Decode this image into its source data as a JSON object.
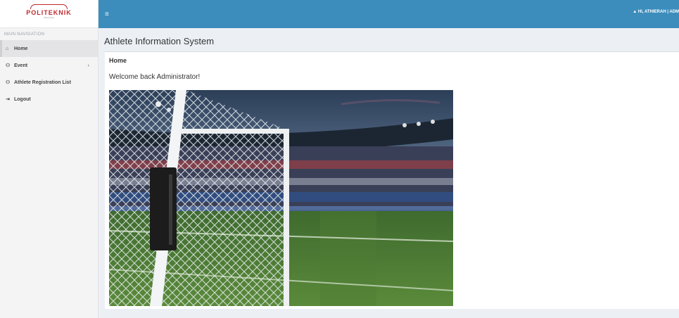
{
  "app": {
    "title": "Athlete Information System",
    "logo_text": "POLITEKNIK",
    "logo_subtext": "MALAYSIA"
  },
  "topbar": {
    "toggle_icon": "hamburger-icon",
    "user_icon": "user-icon",
    "user_greeting": "Hi, ATHIERAH | ADM"
  },
  "sidebar": {
    "header": "MAIN NAVIGATION",
    "items": [
      {
        "label": "Home",
        "icon": "home-icon",
        "active": true
      },
      {
        "label": "Event",
        "icon": "users-icon",
        "has_caret": true
      },
      {
        "label": "Athlete Registration List",
        "icon": "users-icon"
      },
      {
        "label": "Logout",
        "icon": "logout-icon"
      }
    ]
  },
  "main": {
    "panel_heading": "Home",
    "welcome_text": "Welcome back Administrator!",
    "image_subject": "football goal net in stadium at dusk"
  },
  "colors": {
    "topbar": "#3c8dbc",
    "content_bg": "#ecf0f5",
    "sidebar_bg": "#f4f4f5",
    "logo": "#c0282d"
  }
}
